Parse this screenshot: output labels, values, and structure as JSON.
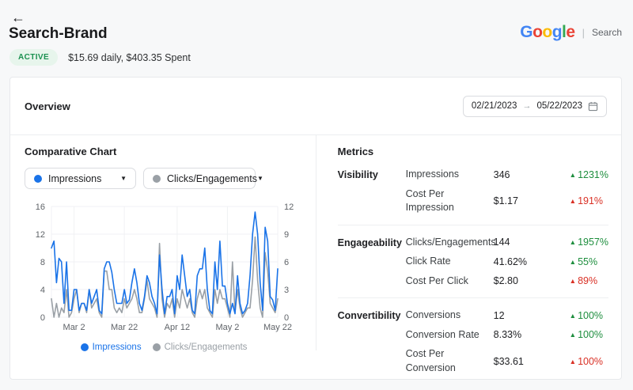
{
  "header": {
    "title": "Search-Brand",
    "status_badge": "ACTIVE",
    "budget_text": "$15.69 daily, $403.35 Spent",
    "platform": {
      "logo_letters": [
        {
          "ch": "G",
          "color": "#4285F4"
        },
        {
          "ch": "o",
          "color": "#EA4335"
        },
        {
          "ch": "o",
          "color": "#FBBC05"
        },
        {
          "ch": "g",
          "color": "#4285F4"
        },
        {
          "ch": "l",
          "color": "#34A853"
        },
        {
          "ch": "e",
          "color": "#EA4335"
        }
      ],
      "separator": "|",
      "channel": "Search"
    }
  },
  "icons": {
    "back": "←",
    "caret_down": "▼",
    "range_arrow": "→",
    "trend_up": "▲"
  },
  "overview": {
    "title": "Overview",
    "date_range": {
      "start": "02/21/2023",
      "end": "05/22/2023"
    }
  },
  "comparative": {
    "title": "Comparative Chart",
    "dropdowns": [
      {
        "label": "Impressions",
        "dot_color": "#1a73e8"
      },
      {
        "label": "Clicks/Engagements",
        "dot_color": "#9aa0a6"
      }
    ],
    "legend": [
      {
        "label": "Impressions",
        "color": "#1a73e8"
      },
      {
        "label": "Clicks/Engagements",
        "color": "#9aa0a6"
      }
    ]
  },
  "chart_data": {
    "type": "line",
    "title": "Comparative Chart",
    "x_start_date": "02/21/2023",
    "x_end_date": "05/22/2023",
    "x_tick_labels": [
      "Mar 2",
      "Mar 22",
      "Apr 12",
      "May 2",
      "May 22"
    ],
    "x_tick_day_index": [
      9,
      29,
      50,
      70,
      90
    ],
    "left_axis": {
      "ticks": [
        0,
        4,
        8,
        12,
        16
      ],
      "range": [
        0,
        16
      ]
    },
    "right_axis": {
      "ticks": [
        0,
        3,
        6,
        9,
        12
      ],
      "range": [
        0,
        12
      ]
    },
    "grid": true,
    "legend_position": "bottom",
    "series": [
      {
        "name": "Impressions",
        "axis": "left",
        "color": "#1a73e8",
        "values": [
          10,
          11,
          5,
          8.5,
          8,
          2,
          8,
          1,
          1,
          4,
          4,
          1,
          2,
          2,
          1,
          4,
          2,
          3,
          4,
          1,
          0.5,
          7,
          8,
          8,
          6.5,
          4,
          2,
          2,
          2,
          4,
          2,
          2.5,
          5,
          7,
          5,
          2,
          1,
          3,
          6,
          5,
          3,
          2,
          0.5,
          9,
          4,
          0.5,
          3,
          3,
          4,
          0.5,
          6,
          4,
          9,
          6,
          3,
          4,
          1,
          0.5,
          6,
          7,
          7,
          10,
          4,
          1,
          0.5,
          8,
          4,
          11,
          4.5,
          4.5,
          2,
          0.5,
          2,
          0.5,
          6,
          2,
          0.5,
          1,
          2,
          6,
          12,
          15.2,
          12,
          5,
          1,
          13,
          11,
          3,
          2.5,
          1,
          7
        ]
      },
      {
        "name": "Clicks/Engagements",
        "axis": "right",
        "color": "#9aa0a6",
        "values": [
          2,
          0,
          1.5,
          0,
          1,
          0.5,
          3,
          0,
          0.5,
          2,
          3,
          0.5,
          1.5,
          1.5,
          0.5,
          3,
          1,
          1.5,
          2,
          0.5,
          0,
          5,
          5,
          3,
          3,
          1,
          0.5,
          1,
          0.5,
          2,
          1,
          1.5,
          2,
          3,
          2,
          0.5,
          0.5,
          2,
          4,
          2,
          1.5,
          1,
          0,
          8,
          2,
          0,
          1.5,
          1,
          2,
          0,
          2,
          1,
          3,
          2,
          1,
          2,
          0.5,
          0,
          2,
          3,
          2,
          3,
          1,
          0.5,
          0,
          3,
          1.5,
          3,
          2,
          2,
          1,
          0,
          6,
          0.5,
          3,
          1,
          0,
          0.5,
          1,
          1,
          4,
          8.7,
          4,
          1,
          0,
          7,
          5,
          1.5,
          1,
          0.5,
          2
        ]
      }
    ]
  },
  "metrics": {
    "title": "Metrics",
    "colors": {
      "good": "#1e8e3e",
      "bad": "#d93025"
    },
    "groups": [
      {
        "name": "Visibility",
        "rows": [
          {
            "label": "Impressions",
            "value": "346",
            "delta": "1231%",
            "trend": "up",
            "good": true
          },
          {
            "label": "Cost Per Impression",
            "value": "$1.17",
            "delta": "191%",
            "trend": "up",
            "good": false
          }
        ]
      },
      {
        "name": "Engageability",
        "rows": [
          {
            "label": "Clicks/Engagements",
            "value": "144",
            "delta": "1957%",
            "trend": "up",
            "good": true
          },
          {
            "label": "Click Rate",
            "value": "41.62%",
            "delta": "55%",
            "trend": "up",
            "good": true
          },
          {
            "label": "Cost Per Click",
            "value": "$2.80",
            "delta": "89%",
            "trend": "up",
            "good": false
          }
        ]
      },
      {
        "name": "Convertibility",
        "rows": [
          {
            "label": "Conversions",
            "value": "12",
            "delta": "100%",
            "trend": "up",
            "good": true
          },
          {
            "label": "Conversion Rate",
            "value": "8.33%",
            "delta": "100%",
            "trend": "up",
            "good": true
          },
          {
            "label": "Cost Per Conversion",
            "value": "$33.61",
            "delta": "100%",
            "trend": "up",
            "good": false
          }
        ]
      }
    ]
  }
}
